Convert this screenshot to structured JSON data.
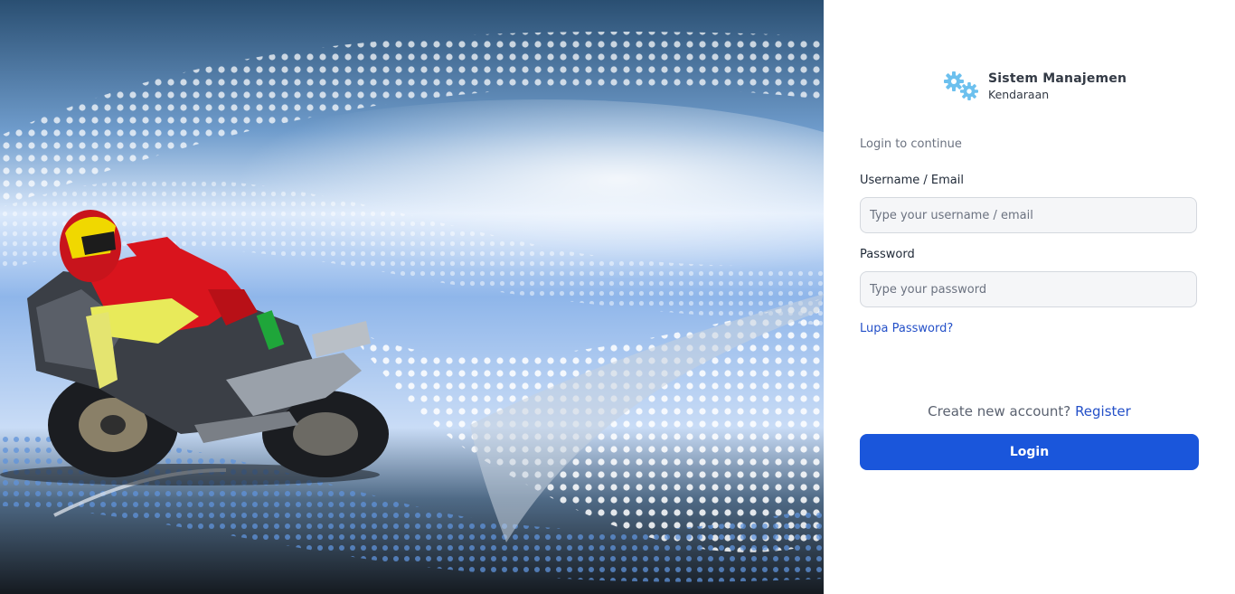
{
  "brand": {
    "title": "Sistem Manajemen",
    "subtitle": "Kendaraan",
    "icon": "gears-icon",
    "icon_color": "#6cc0ee"
  },
  "form": {
    "subtitle": "Login to continue",
    "username_label": "Username / Email",
    "username_placeholder": "Type your username / email",
    "username_value": "",
    "password_label": "Password",
    "password_placeholder": "Type your password",
    "password_value": "",
    "forgot_link": "Lupa Password?",
    "register_prompt": "Create new account?",
    "register_link": "Register",
    "login_button": "Login"
  },
  "colors": {
    "accent": "#1a56db",
    "link": "#2450c8"
  },
  "hero": {
    "image": "motorcycle-rider-halftone-illustration"
  }
}
